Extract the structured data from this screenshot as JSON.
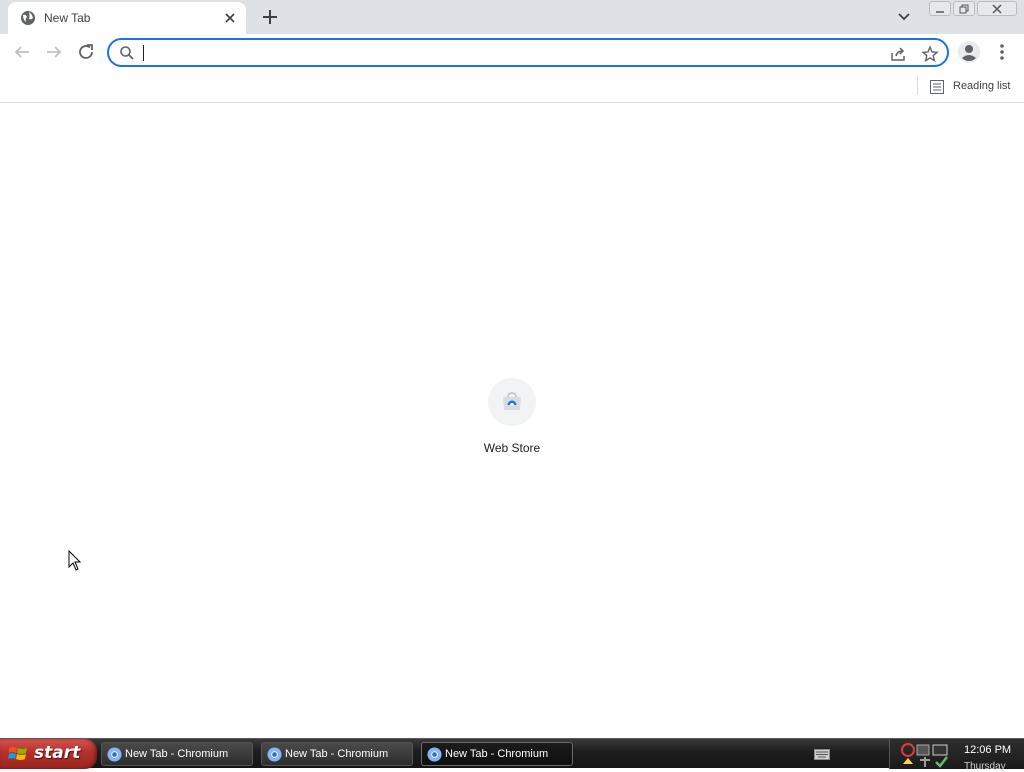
{
  "tab": {
    "title": "New Tab"
  },
  "omnibox": {
    "value": "",
    "placeholder": ""
  },
  "bookmarks_bar": {
    "reading_list_label": "Reading list"
  },
  "shortcuts": [
    {
      "label": "Web Store",
      "icon": "web-store-icon"
    }
  ],
  "taskbar": {
    "start_label": "start",
    "tasks": [
      {
        "label": "New Tab - Chromium",
        "active": false
      },
      {
        "label": "New Tab - Chromium",
        "active": false
      },
      {
        "label": "New Tab - Chromium",
        "active": true
      }
    ],
    "clock_time": "12:06 PM",
    "clock_day": "Thursday"
  },
  "colors": {
    "accent": "#1a73e8",
    "tabstrip_bg": "#dee1e6",
    "start_button": "#b3302a",
    "taskbar_bg": "#1f1f1f"
  }
}
